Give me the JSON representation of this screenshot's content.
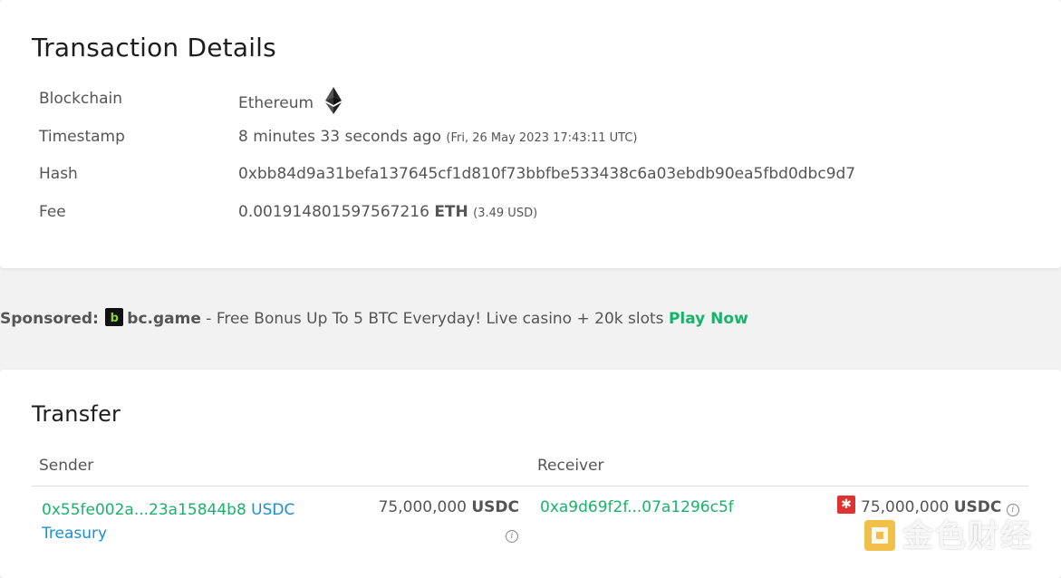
{
  "details": {
    "title": "Transaction Details",
    "blockchain_label": "Blockchain",
    "blockchain_value": "Ethereum",
    "timestamp_label": "Timestamp",
    "timestamp_relative": "8 minutes 33 seconds ago",
    "timestamp_absolute": "(Fri, 26 May 2023 17:43:11 UTC)",
    "hash_label": "Hash",
    "hash_value": "0xbb84d9a31befa137645cf1d810f73bbfbe533438c6a03ebdb90ea5fbd0dbc9d7",
    "fee_label": "Fee",
    "fee_amount": "0.001914801597567216",
    "fee_unit": "ETH",
    "fee_usd": "(3.49 USD)"
  },
  "sponsored": {
    "lead": "Sponsored:",
    "brand": "bc.game",
    "text": " - Free Bonus Up To 5 BTC Everyday! Live casino + 20k slots ",
    "cta": "Play Now"
  },
  "transfer": {
    "title": "Transfer",
    "sender_header": "Sender",
    "receiver_header": "Receiver",
    "sender_address": "0x55fe002a...23a15844b8",
    "sender_name": "USDC Treasury",
    "sender_amount": "75,000,000",
    "sender_unit": "USDC",
    "receiver_address": "0xa9d69f2f...07a1296c5f",
    "receiver_amount": "75,000,000",
    "receiver_unit": "USDC"
  },
  "watermark": {
    "text": "金色财经"
  },
  "colors": {
    "link_green": "#19b26b",
    "link_blue": "#1a8fd1",
    "alert_red": "#e0332f"
  },
  "icons": {
    "chain": "ethereum-icon",
    "info": "info-icon",
    "alert": "alert-icon",
    "sponsor": "bc-game-logo"
  }
}
